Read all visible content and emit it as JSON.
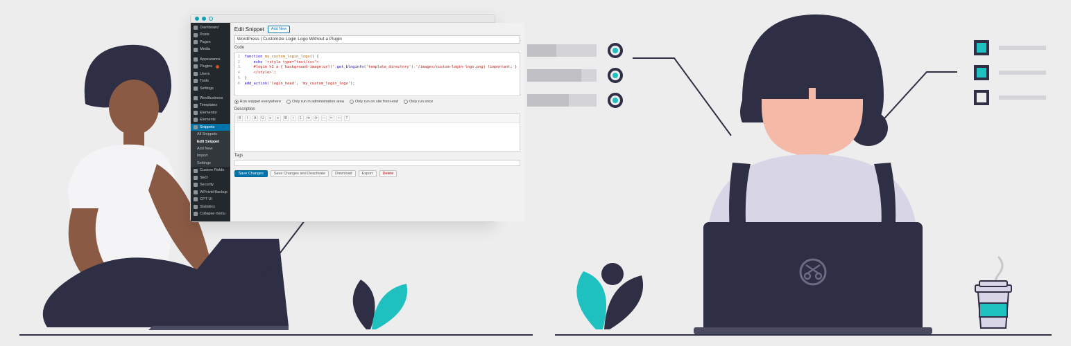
{
  "sidebar": {
    "items": [
      {
        "label": "Dashboard"
      },
      {
        "label": "Posts"
      },
      {
        "label": "Pages"
      },
      {
        "label": "Media"
      },
      {
        "label": "Appearance"
      },
      {
        "label": "Plugins"
      },
      {
        "label": "Users"
      },
      {
        "label": "Tools"
      },
      {
        "label": "Settings"
      },
      {
        "label": "WooBusiness"
      },
      {
        "label": "Templates"
      },
      {
        "label": "Elementor"
      },
      {
        "label": "Elements"
      },
      {
        "label": "Snippets"
      },
      {
        "label": "All Snippets",
        "sub": true
      },
      {
        "label": "Edit Snippet",
        "sub": true,
        "current": true
      },
      {
        "label": "Add New",
        "sub": true
      },
      {
        "label": "Import",
        "sub": true
      },
      {
        "label": "Settings",
        "sub": true
      },
      {
        "label": "Custom Fields"
      },
      {
        "label": "SEO"
      },
      {
        "label": "Security"
      },
      {
        "label": "WPvivid Backup"
      },
      {
        "label": "CPT UI"
      },
      {
        "label": "Statistics"
      },
      {
        "label": "Collapse menu"
      }
    ]
  },
  "header": {
    "title": "Edit Snippet",
    "add_new": "Add New"
  },
  "snippet": {
    "title": "WordPress | Customize Login Logo Without a Plugin",
    "code_label": "Code",
    "code_lines": [
      {
        "n": "1",
        "seg": [
          [
            "fn",
            "function"
          ],
          [
            "pl",
            " "
          ],
          [
            "var",
            "my_custom_login_logo"
          ],
          [
            "pl",
            "() {"
          ]
        ]
      },
      {
        "n": "2",
        "seg": [
          [
            "pl",
            "    "
          ],
          [
            "fn",
            "echo"
          ],
          [
            "pl",
            " "
          ],
          [
            "str",
            "'<style type=\"text/css\">"
          ]
        ]
      },
      {
        "n": "3",
        "seg": [
          [
            "pl",
            "    "
          ],
          [
            "str",
            "#login h1 a { background-image:url('"
          ],
          [
            "pl",
            "."
          ],
          [
            "fn",
            "get_bloginfo"
          ],
          [
            "pl",
            "("
          ],
          [
            "str",
            "'template_directory'"
          ],
          [
            "pl",
            ")."
          ],
          [
            "str",
            "'/images/custom-login-logo.png) !important; }"
          ]
        ]
      },
      {
        "n": "4",
        "seg": [
          [
            "pl",
            "    "
          ],
          [
            "str",
            "</style>'"
          ],
          [
            "pl",
            ";"
          ]
        ]
      },
      {
        "n": "5",
        "seg": [
          [
            "pl",
            "}"
          ]
        ]
      },
      {
        "n": "6",
        "seg": [
          [
            "fn",
            "add_action"
          ],
          [
            "pl",
            "("
          ],
          [
            "str",
            "'login_head'"
          ],
          [
            "pl",
            ", "
          ],
          [
            "str",
            "'my_custom_login_logo'"
          ],
          [
            "pl",
            ");"
          ]
        ]
      }
    ],
    "scope": {
      "options": [
        {
          "label": "Run snippet everywhere",
          "on": true
        },
        {
          "label": "Only run in administration area",
          "on": false
        },
        {
          "label": "Only run on site front-end",
          "on": false
        },
        {
          "label": "Only run once",
          "on": false
        }
      ]
    },
    "description_label": "Description",
    "toolbar": [
      "B",
      "I",
      "A",
      "U",
      "≡",
      "≡",
      "≣",
      "•",
      "1.",
      "⟲",
      "⟳",
      "—",
      "✂",
      "□",
      "?"
    ],
    "tags_label": "Tags",
    "buttons": {
      "save": "Save Changes",
      "save_deactivate": "Save Changes and Deactivate",
      "download": "Download",
      "export": "Export",
      "delete": "Delete"
    }
  },
  "bars": {
    "rows": [
      {
        "fill_pct": 42,
        "radio_on": true
      },
      {
        "fill_pct": 78,
        "radio_on": true
      },
      {
        "fill_pct": 60,
        "radio_on": true
      }
    ]
  },
  "checks": {
    "rows": [
      {
        "on": true
      },
      {
        "on": true
      },
      {
        "on": false
      }
    ]
  }
}
